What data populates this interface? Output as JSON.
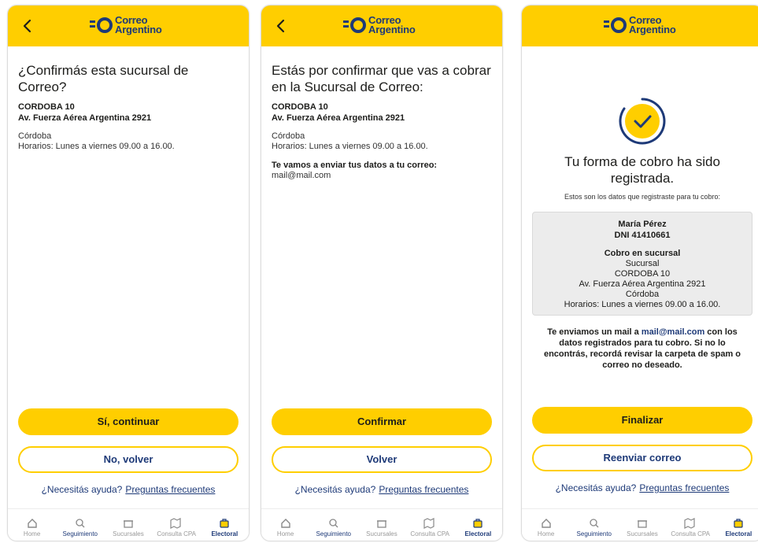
{
  "brand": {
    "name_line1": "Correo",
    "name_line2": "Argentino",
    "colors": {
      "yellow": "#ffce00",
      "navy": "#1e3a78"
    }
  },
  "branch": {
    "name": "CORDOBA 10",
    "address": "Av. Fuerza Aérea Argentina 2921",
    "city": "Córdoba",
    "hours": "Horarios: Lunes a viernes 09.00 a 16.00."
  },
  "screen1": {
    "title": "¿Confirmás esta sucursal de Correo?",
    "primary_label": "Sí, continuar",
    "secondary_label": "No, volver"
  },
  "screen2": {
    "title": "Estás por confirmar que vas a cobrar en la Sucursal de Correo:",
    "email_notice": "Te vamos a enviar tus datos a tu correo:",
    "email": "mail@mail.com",
    "primary_label": "Confirmar",
    "secondary_label": "Volver"
  },
  "screen3": {
    "title": "Tu forma de cobro ha sido registrada.",
    "subtitle": "Estos son los datos que registraste para tu cobro:",
    "person_name": "María Pérez",
    "dni": "DNI 41410661",
    "method_title": "Cobro en sucursal",
    "method_type": "Sucursal",
    "mail_prefix": "Te enviamos un mail a",
    "mail_address": "mail@mail.com",
    "mail_suffix": "con los datos registrados para tu cobro. Si no lo encontrás, recordá revisar la carpeta de spam o correo no deseado.",
    "primary_label": "Finalizar",
    "secondary_label": "Reenviar correo"
  },
  "help": {
    "question": "¿Necesitás ayuda?",
    "link": "Preguntas frecuentes"
  },
  "tabbar": {
    "home": "Home",
    "tracking": "Seguimiento",
    "branches": "Sucursales",
    "cpa": "Consulta CPA",
    "electoral": "Electoral"
  }
}
